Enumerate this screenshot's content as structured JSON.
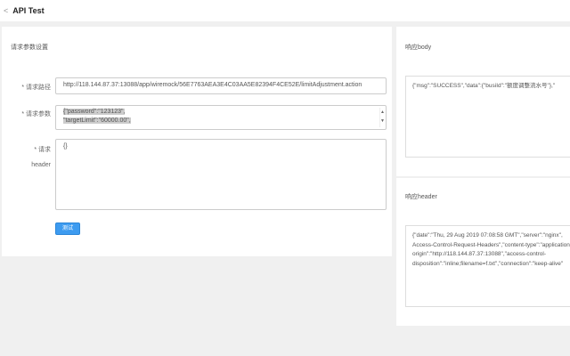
{
  "header": {
    "back_icon": "chevron-left-icon",
    "title": "API Test"
  },
  "request": {
    "section_title": "请求参数设置",
    "url_label": "* 请求路径",
    "url_value": "http://118.144.87.37:13088/app/wiremock/56E7763AEA3E4C03AA5E82394F4CE52E/limitAdjustment.action",
    "params_label": "* 请求参数",
    "params_lines": [
      "{\"password\":\"123123\",",
      "\"targetLimit\":\"60000.00\","
    ],
    "header_label_1": "* 请求",
    "header_label_2": "header",
    "header_value": "{}",
    "test_button": "测试"
  },
  "response": {
    "body_title": "响应body",
    "body_value": "{\"msg\":\"SUCCESS\",\"data\":{\"busiId\":\"额度调整流水号\"},\"",
    "header_title": "响应header",
    "header_lines": [
      "{\"date\":\"Thu, 29 Aug 2019 07:08:58 GMT\",\"server\":\"nginx\",",
      "Access-Control-Request-Headers\",\"content-type\":\"application",
      "origin\":\"http://118.144.87.37:13088\",\"access-control-",
      "disposition\":\"inline;filename=f.txt\",\"connection\":\"keep-alive\""
    ]
  }
}
